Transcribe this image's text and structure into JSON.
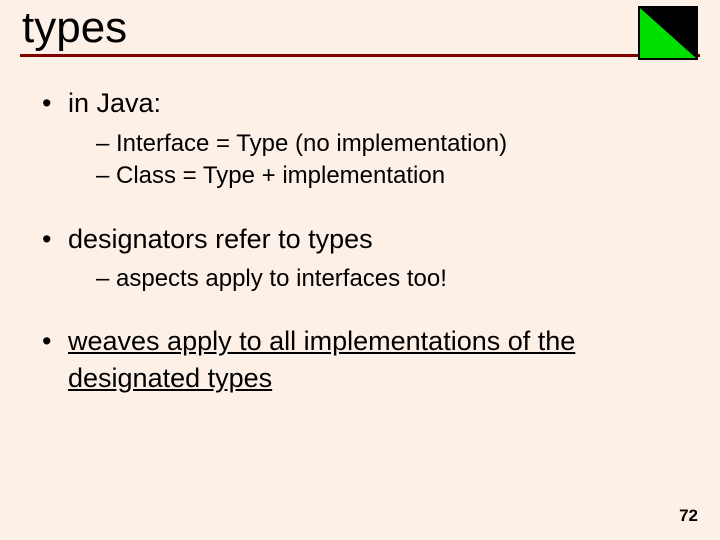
{
  "title": "types",
  "bullets": {
    "b1": {
      "text": "in Java:",
      "sub": {
        "s1": "Interface = Type (no implementation)",
        "s2": "Class = Type + implementation"
      }
    },
    "b2": {
      "text": "designators refer to types",
      "sub": {
        "s1": "aspects apply to interfaces too!"
      }
    },
    "b3": {
      "text": "weaves apply to all implementations of the designated types"
    }
  },
  "page_number": "72",
  "logo": {
    "name": "corner-triangle-logo",
    "fill": "#00e000",
    "outline": "#000000"
  }
}
